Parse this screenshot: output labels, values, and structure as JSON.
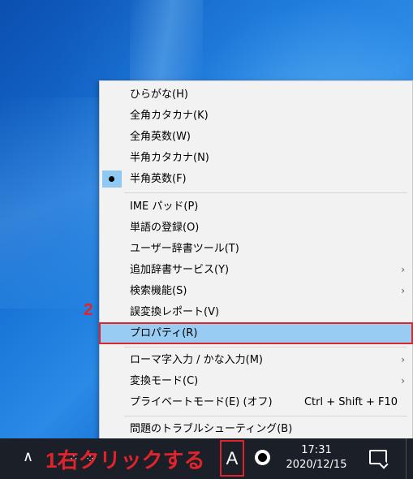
{
  "menu": {
    "items": [
      {
        "label": "ひらがな(H)"
      },
      {
        "label": "全角カタカナ(K)"
      },
      {
        "label": "全角英数(W)"
      },
      {
        "label": "半角カタカナ(N)"
      },
      {
        "label": "半角英数(F)"
      },
      {
        "label": "IME パッド(P)"
      },
      {
        "label": "単語の登録(O)"
      },
      {
        "label": "ユーザー辞書ツール(T)"
      },
      {
        "label": "追加辞書サービス(Y)"
      },
      {
        "label": "検索機能(S)"
      },
      {
        "label": "誤変換レポート(V)"
      },
      {
        "label": "プロパティ(R)"
      },
      {
        "label": "ローマ字入力 / かな入力(M)"
      },
      {
        "label": "変換モード(C)"
      },
      {
        "label": "プライベートモード(E) (オフ)",
        "shortcut": "Ctrl + Shift + F10"
      },
      {
        "label": "問題のトラブルシューティング(B)"
      }
    ],
    "submenu_arrow": "›"
  },
  "annotations": {
    "step1_number": "1",
    "step1_text": "右クリックする",
    "step2_number": "2"
  },
  "taskbar": {
    "up_arrow": "∧",
    "ime_mode": "A",
    "time": "17:31",
    "date": "2020/12/15"
  },
  "icons": {
    "ime": "ime-mode-icon",
    "app": "app-tray-icon",
    "notification": "notification-icon"
  },
  "colors": {
    "highlight": "#99ccf3",
    "annotation_red": "#e0242b",
    "taskbar": "#1b1f27"
  }
}
